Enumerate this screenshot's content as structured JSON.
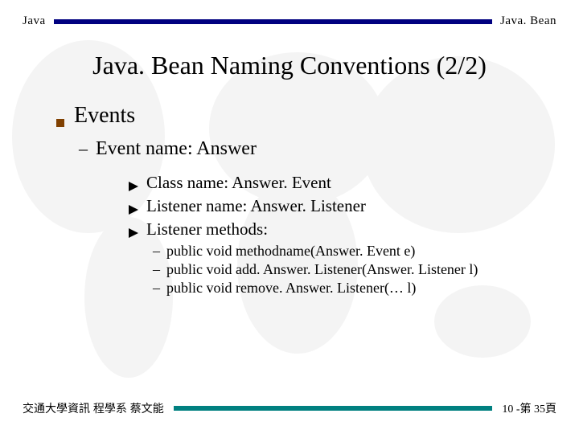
{
  "header": {
    "left": "Java",
    "right": "Java. Bean"
  },
  "title": "Java. Bean Naming Conventions (2/2)",
  "content": {
    "section": "Events",
    "sub1": "Event name: Answer",
    "items": [
      "Class name: Answer. Event",
      "Listener name: Answer. Listener",
      "Listener methods:"
    ],
    "methods": [
      "public void methodname(Answer. Event e)",
      "public void add. Answer. Listener(Answer. Listener l)",
      "public void remove. Answer. Listener(…  l)"
    ]
  },
  "footer": {
    "left": "交通大學資訊 程學系 蔡文能",
    "right": "10 -第 35頁"
  }
}
